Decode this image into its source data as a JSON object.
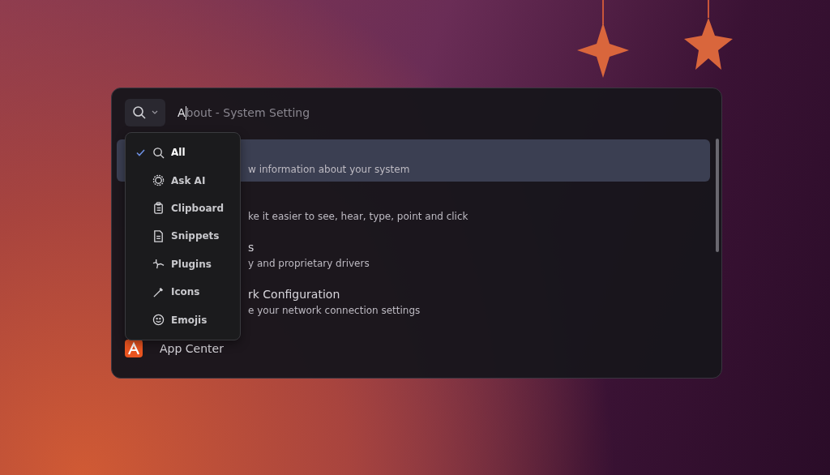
{
  "search": {
    "value": "A",
    "suggestion": "bout - System Setting"
  },
  "filter_menu": {
    "items": [
      {
        "label": "All",
        "selected": true
      },
      {
        "label": "Ask AI",
        "selected": false
      },
      {
        "label": "Clipboard",
        "selected": false
      },
      {
        "label": "Snippets",
        "selected": false
      },
      {
        "label": "Plugins",
        "selected": false
      },
      {
        "label": "Icons",
        "selected": false
      },
      {
        "label": "Emojis",
        "selected": false
      }
    ]
  },
  "results": [
    {
      "subtitle": "w information about your system",
      "selected": true,
      "covered": true
    },
    {
      "subtitle": "ke it easier to see, hear, type, point and click",
      "selected": false,
      "covered": true
    },
    {
      "title": "s",
      "subtitle": "y and proprietary drivers",
      "selected": false,
      "covered": true
    },
    {
      "title": "rk Configuration",
      "subtitle": "e your network connection settings",
      "selected": false,
      "covered": true
    },
    {
      "title": "App Center",
      "selected": false,
      "covered": false
    }
  ]
}
